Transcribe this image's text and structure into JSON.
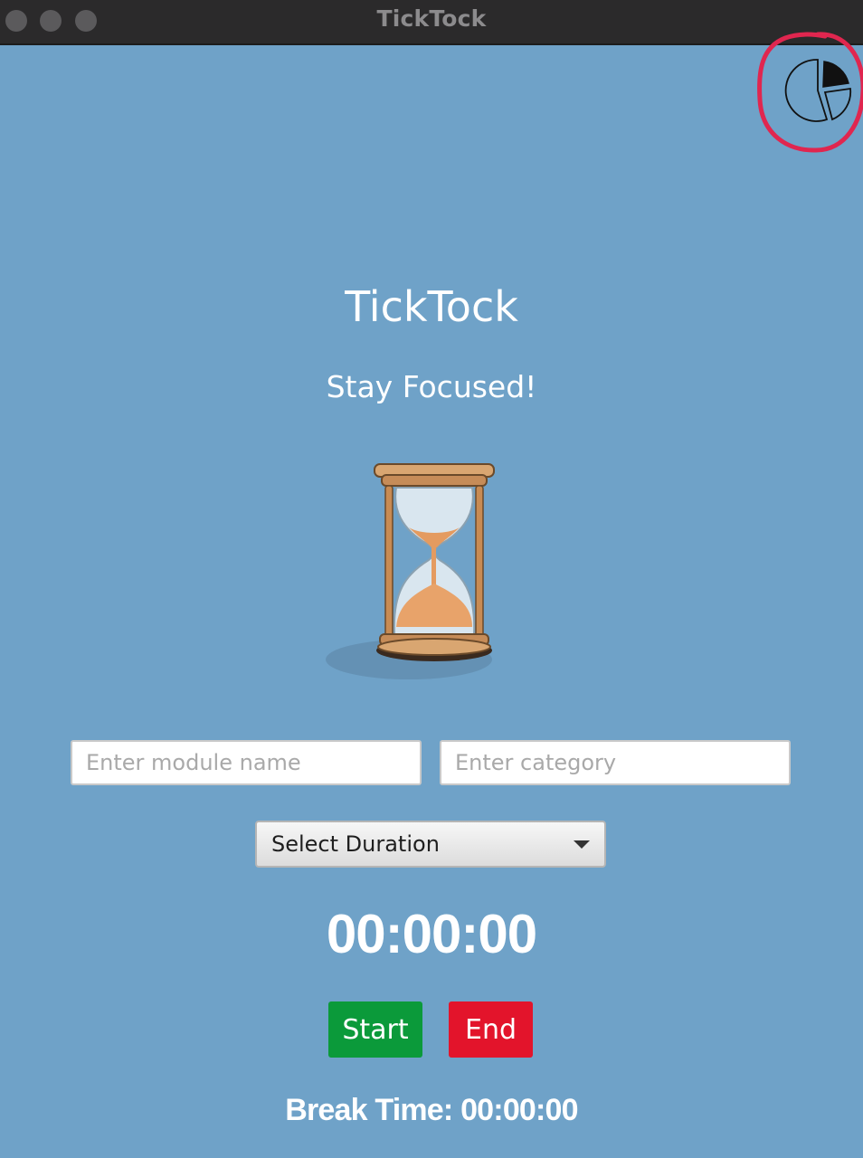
{
  "window": {
    "title": "TickTock"
  },
  "header": {
    "stats_icon": "pie-chart-icon"
  },
  "main": {
    "title": "TickTock",
    "subtitle": "Stay Focused!",
    "illustration": "hourglass-icon"
  },
  "form": {
    "module_placeholder": "Enter module name",
    "module_value": "",
    "category_placeholder": "Enter category",
    "category_value": "",
    "duration_selected": "Select Duration"
  },
  "timer": {
    "display": "00:00:00"
  },
  "controls": {
    "start_label": "Start",
    "end_label": "End"
  },
  "break": {
    "text": "Break Time: 00:00:00"
  },
  "colors": {
    "background": "#6fa2c8",
    "start": "#0b9a3a",
    "end": "#e3142b",
    "highlight": "#e0264f"
  }
}
